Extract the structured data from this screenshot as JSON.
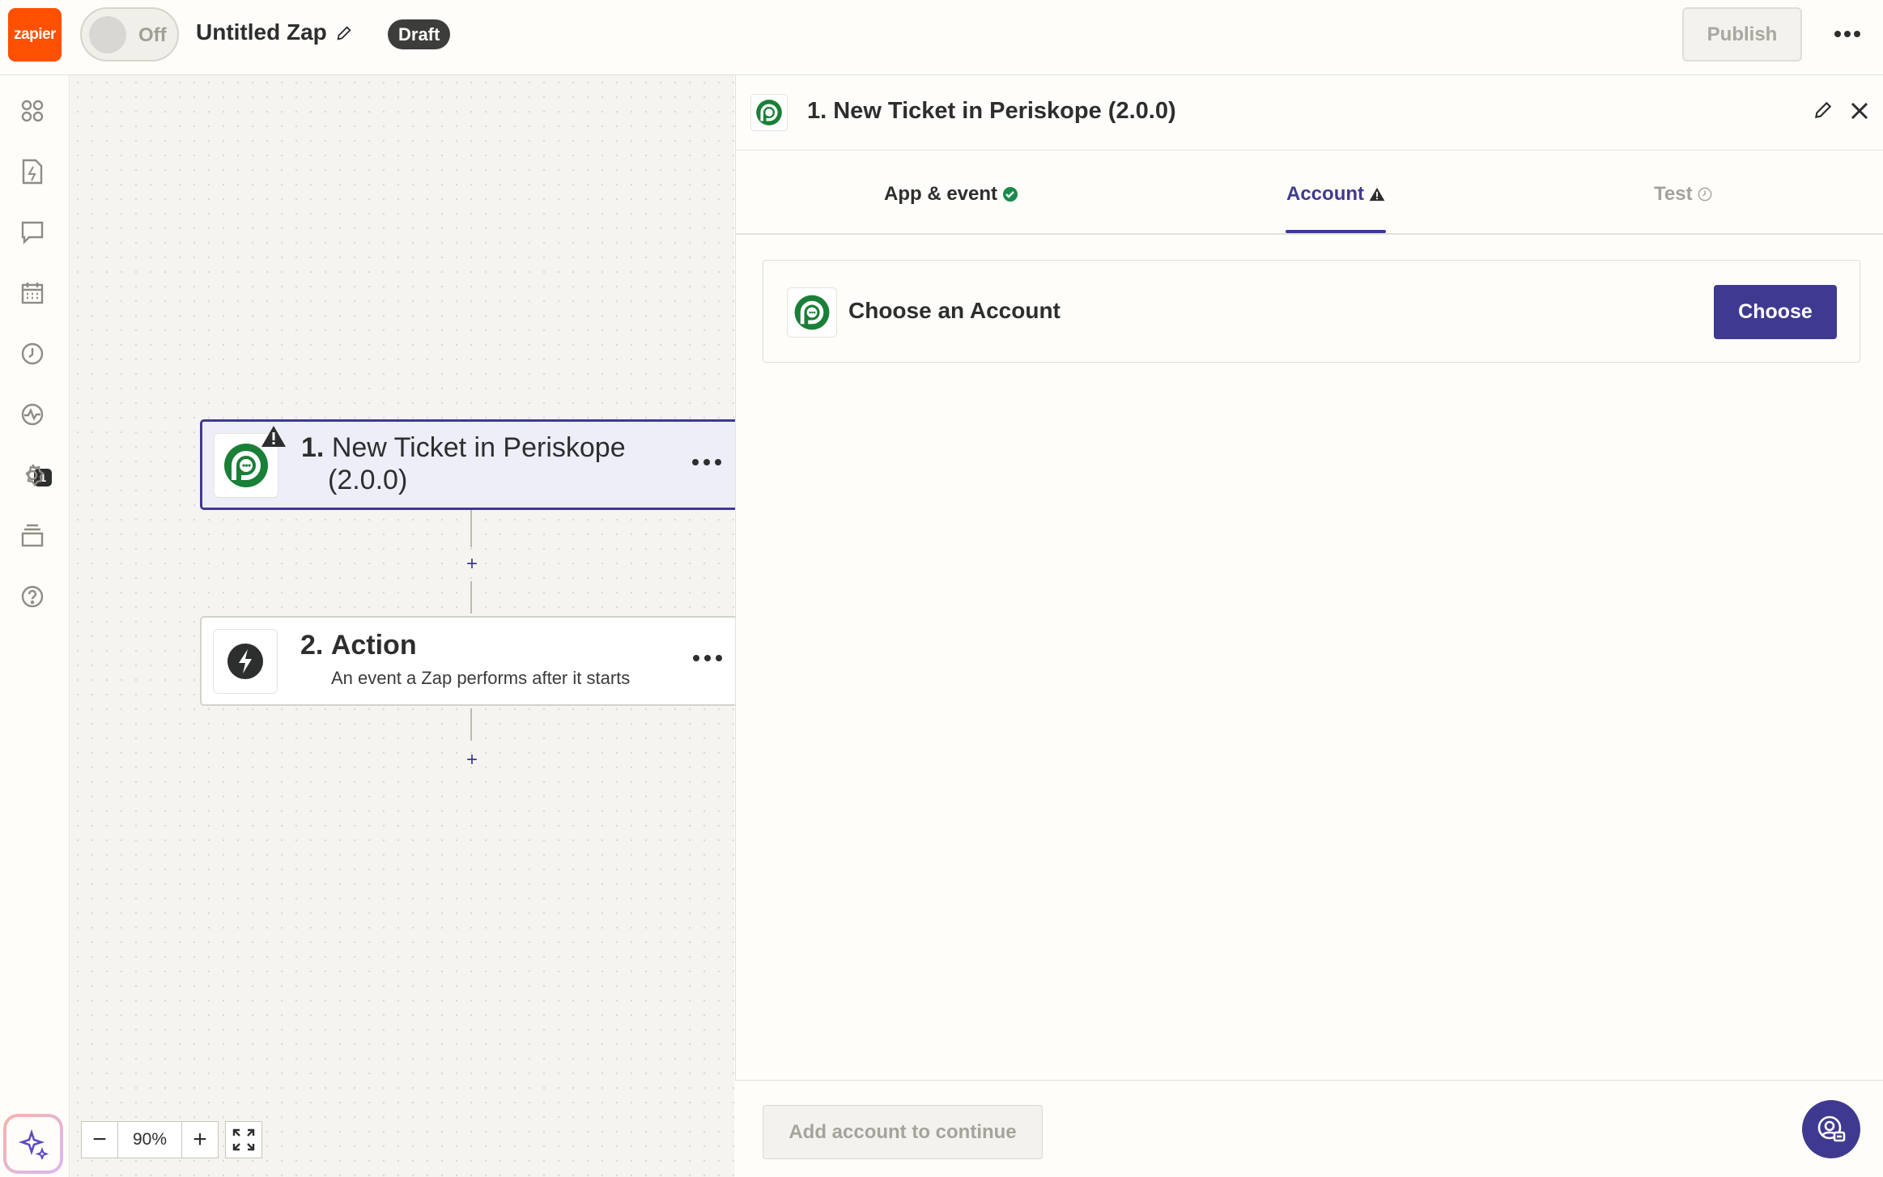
{
  "topbar": {
    "logo_text": "zapier",
    "toggle_label": "Off",
    "zap_name": "Untitled Zap",
    "status_badge": "Draft",
    "publish_label": "Publish"
  },
  "sidenav": {
    "icons": [
      "apps-icon",
      "zap-file-icon",
      "comment-icon",
      "calendar-icon",
      "history-icon",
      "activity-icon",
      "settings-icon",
      "versions-icon",
      "help-icon"
    ],
    "activity_badge": "1"
  },
  "canvas": {
    "steps": [
      {
        "number": "1.",
        "title_line1": "New Ticket in Periskope",
        "title_line2": "(2.0.0)",
        "subtitle": ""
      },
      {
        "number": "2.",
        "title_line1": "Action",
        "subtitle": "An event a Zap performs after it starts"
      }
    ],
    "add_symbol": "+",
    "zoom": {
      "minus": "−",
      "value": "90%",
      "plus": "+"
    }
  },
  "panel": {
    "title": "1. New Ticket in Periskope (2.0.0)",
    "tabs": [
      {
        "label": "App & event",
        "status": "complete"
      },
      {
        "label": "Account",
        "status": "warning"
      },
      {
        "label": "Test",
        "status": "pending"
      }
    ],
    "active_tab": "Account",
    "account_card": {
      "title": "Choose an Account",
      "button": "Choose"
    },
    "footer_button": "Add account to continue"
  },
  "colors": {
    "brand": "#ff4f00",
    "accent": "#3f3a90",
    "periskope_green": "#1a7f37",
    "success": "#1a8a4a"
  }
}
